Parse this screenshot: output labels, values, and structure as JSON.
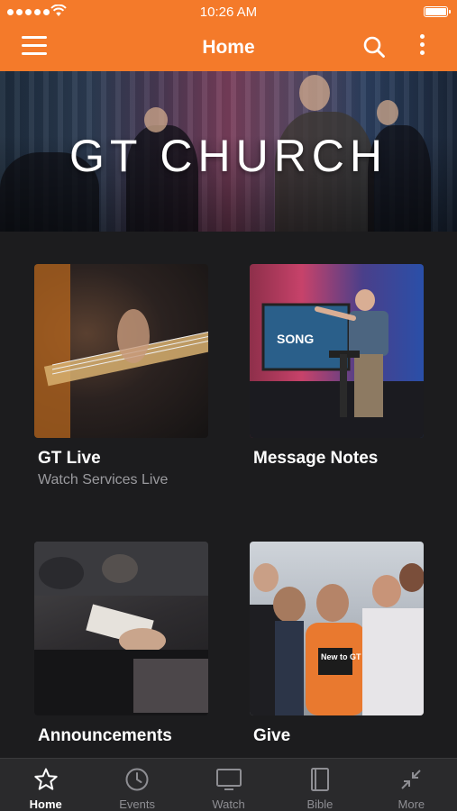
{
  "status_bar": {
    "time": "10:26 AM"
  },
  "header": {
    "title": "Home"
  },
  "hero": {
    "title": "GT CHURCH"
  },
  "tiles": [
    {
      "label": "GT Live",
      "subtitle": "Watch Services Live"
    },
    {
      "label": "Message Notes",
      "subtitle": ""
    },
    {
      "label": "Announcements",
      "subtitle": ""
    },
    {
      "label": "Give",
      "subtitle": ""
    }
  ],
  "tile_images": {
    "notes_screen_text": "SONG",
    "give_shirt_text": "New to GT"
  },
  "bottom_nav": [
    {
      "label": "Home",
      "icon": "star-icon",
      "active": true
    },
    {
      "label": "Events",
      "icon": "clock-icon",
      "active": false
    },
    {
      "label": "Watch",
      "icon": "tv-icon",
      "active": false
    },
    {
      "label": "Bible",
      "icon": "book-icon",
      "active": false
    },
    {
      "label": "More",
      "icon": "collapse-arrows-icon",
      "active": false
    }
  ],
  "colors": {
    "accent": "#f47a2a",
    "background": "#1c1c1e",
    "nav_background": "#2a2a2c",
    "muted_text": "#9a9a9e"
  }
}
